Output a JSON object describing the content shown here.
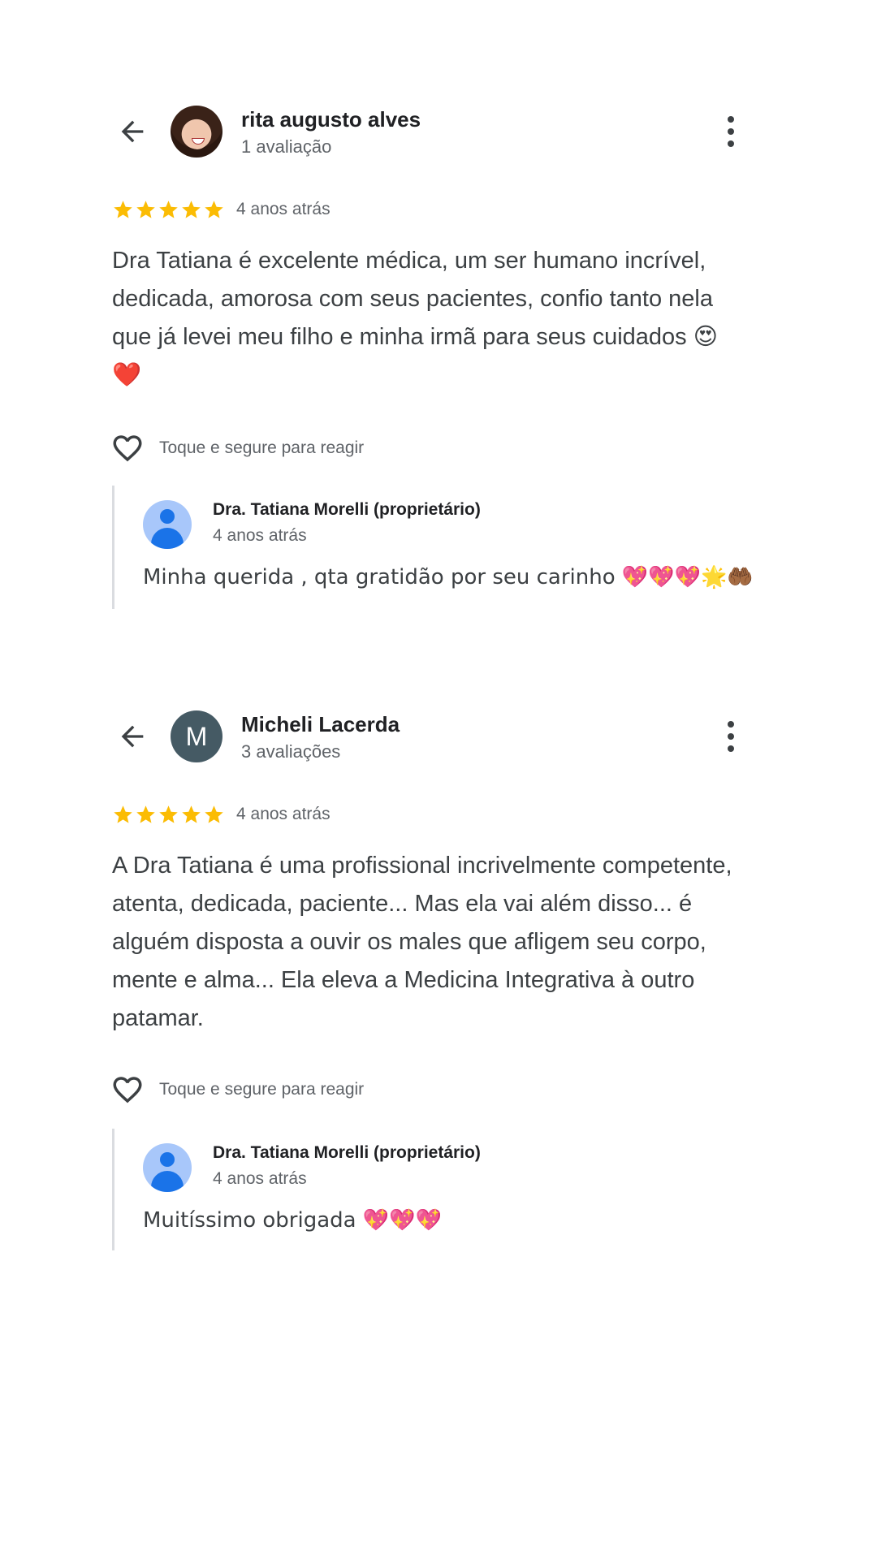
{
  "reviews": [
    {
      "reviewer_name": "rita augusto alves",
      "reviewer_count": "1 avaliação",
      "avatar_letter": "",
      "rating": 5,
      "date": "4 anos atrás",
      "text": "Dra Tatiana é excelente médica, um ser humano incrível, dedicada, amorosa com seus pacientes, confio tanto nela que já levei meu filho e minha irmã para seus cuidados 😍❤️",
      "react_label": "Toque e segure para reagir",
      "reply": {
        "name": "Dra. Tatiana Morelli (proprietário)",
        "date": "4 anos atrás",
        "text": "Minha querida , qta gratidão por seu carinho 💖💖💖🌟🤲🏾"
      }
    },
    {
      "reviewer_name": "Micheli Lacerda",
      "reviewer_count": "3 avaliações",
      "avatar_letter": "M",
      "rating": 5,
      "date": "4 anos atrás",
      "text": "A Dra Tatiana é uma profissional incrivelmente competente, atenta, dedicada, paciente... Mas ela vai além disso... é alguém disposta a ouvir os males que afligem seu corpo, mente e alma... Ela eleva a Medicina Integrativa à outro patamar.",
      "react_label": "Toque e segure para reagir",
      "reply": {
        "name": "Dra. Tatiana Morelli (proprietário)",
        "date": "4 anos atrás",
        "text": "Muitíssimo obrigada 💖💖💖"
      }
    }
  ],
  "colors": {
    "star": "#fbbc04",
    "avatar_letter_bg": "#455a64",
    "owner_avatar_bg": "#a8c7fa",
    "owner_avatar_fg": "#1a73e8",
    "text_primary": "#202124",
    "text_secondary": "#5f6368"
  },
  "icons": {
    "back": "arrow-left-icon",
    "more": "more-vert-icon",
    "star": "star-icon",
    "heart": "heart-outline-icon"
  }
}
